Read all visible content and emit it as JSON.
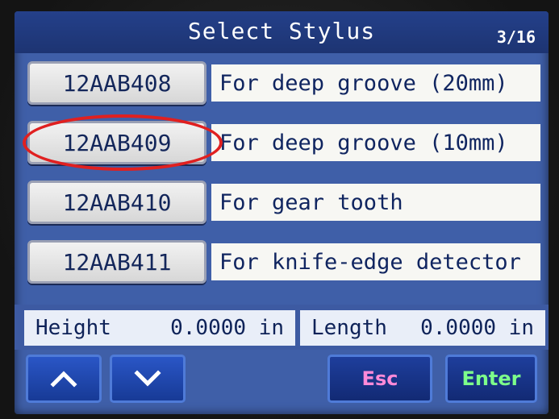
{
  "header": {
    "title": "Select Stylus",
    "page": "3/16"
  },
  "styli": [
    {
      "code": "12AAB408",
      "description": "For deep groove (20mm)"
    },
    {
      "code": "12AAB409",
      "description": "For deep groove (10mm)"
    },
    {
      "code": "12AAB410",
      "description": "For gear tooth"
    },
    {
      "code": "12AAB411",
      "description": "For knife-edge detector"
    }
  ],
  "info": {
    "height_label": "Height",
    "height_value": "0.0000 in",
    "length_label": "Length",
    "length_value": "0.0000 in"
  },
  "buttons": {
    "up_icon": "chevron-up-icon",
    "down_icon": "chevron-down-icon",
    "esc_label": "Esc",
    "enter_label": "Enter"
  },
  "colors": {
    "screen_bg": "#3f5fa8",
    "titlebar": "#1d3472",
    "highlight": "#e02020",
    "esc_text": "#ff8ad8",
    "enter_text": "#7dff8a"
  }
}
